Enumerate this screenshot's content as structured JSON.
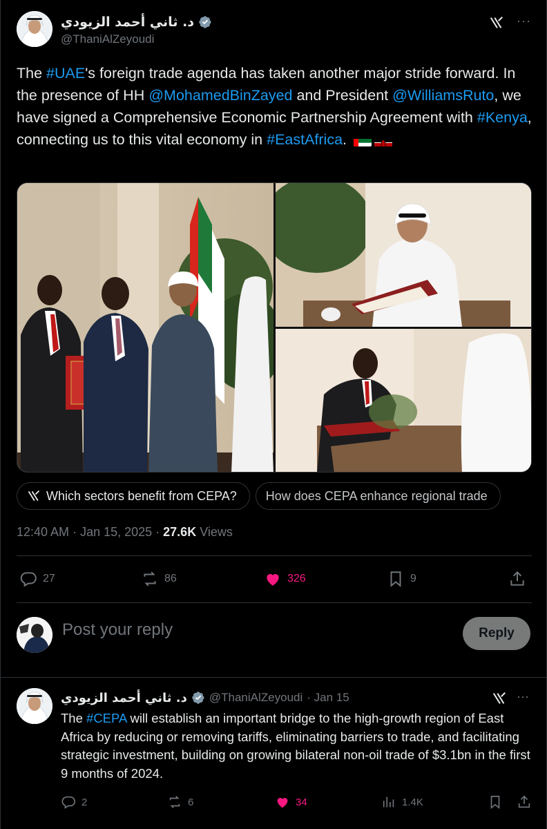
{
  "tweet": {
    "author": {
      "display_name": "د. ثاني أحمد الزيودي",
      "handle": "@ThaniAlZeyoudi",
      "verified": true
    },
    "text_parts": {
      "p1": "The ",
      "l1": "#UAE",
      "p2": "'s foreign trade agenda has taken another major stride forward. In the presence of HH ",
      "l2": "@MohamedBinZayed",
      "p3": " and President ",
      "l3": "@WilliamsRuto",
      "p4": ", we have signed a Comprehensive Economic Partnership Agreement with ",
      "l4": "#Kenya",
      "p5": ", connecting us to this vital economy in ",
      "l5": "#EastAfrica",
      "p6": "."
    },
    "flags": [
      "uae-flag",
      "kenya-flag"
    ],
    "grok_prompts": [
      "Which sectors benefit from CEPA?",
      "How does CEPA enhance regional trade"
    ],
    "meta": {
      "time": "12:40 AM",
      "sep1": " · ",
      "date": "Jan 15, 2025",
      "sep2": " · ",
      "views": "27.6K",
      "views_label": " Views"
    },
    "stats": {
      "replies": "27",
      "reposts": "86",
      "likes": "326",
      "bookmarks": "9"
    },
    "liked": true
  },
  "composer": {
    "placeholder": "Post your reply",
    "button": "Reply"
  },
  "reply_tweet": {
    "author": {
      "display_name": "د. ثاني أحمد الزيودي",
      "handle": "@ThaniAlZeyoudi",
      "date": "· Jan 15"
    },
    "text_parts": {
      "p1": "The ",
      "l1": "#CEPA",
      "p2": " will establish an important bridge to the high-growth region of East Africa by reducing or removing tariffs, eliminating barriers to trade, and facilitating strategic investment, building on growing bilateral non-oil trade of $3.1bn in the first 9 months of 2024."
    },
    "stats": {
      "replies": "2",
      "reposts": "6",
      "likes": "34",
      "views": "1.4K"
    }
  },
  "colors": {
    "background": "#000000",
    "text": "#e7e9ea",
    "muted": "#71767b",
    "link": "#1d9bf0",
    "like": "#f91880",
    "border": "#2f3336"
  }
}
